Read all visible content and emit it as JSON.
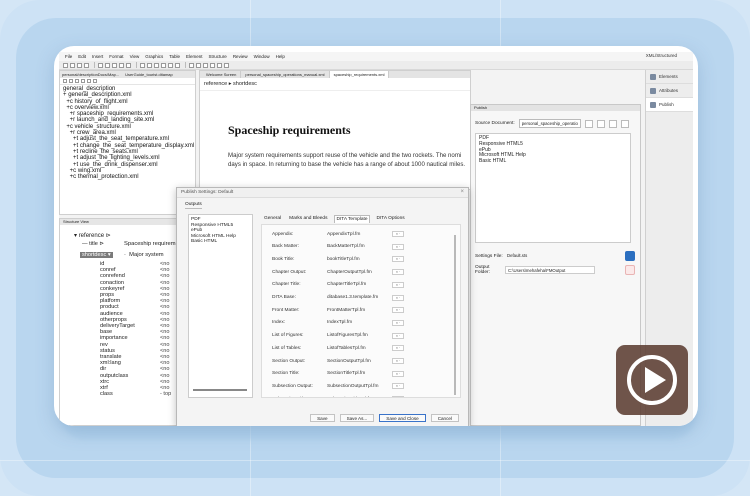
{
  "menubar": {
    "items": [
      "File",
      "Edit",
      "Insert",
      "Format",
      "View",
      "Graphics",
      "Table",
      "Element",
      "Structure",
      "Review",
      "Window",
      "Help"
    ],
    "right_label": "XML/Structured"
  },
  "rightbar": {
    "items": [
      {
        "label": "Elements",
        "icon": "elements-icon"
      },
      {
        "label": "Attributes",
        "icon": "attributes-icon"
      },
      {
        "label": "Publish",
        "icon": "publish-icon",
        "active": true
      }
    ]
  },
  "leftpanel": {
    "tabs": [
      "personal/descriptionDocs/Map...",
      "UserGuide_tourist.ditamap"
    ],
    "tree": [
      {
        "prefix": "",
        "label": "general_description"
      },
      {
        "prefix": "+",
        "label": "general_description.xml"
      },
      {
        "prefix": "  +c",
        "label": "history_of_flight.xml"
      },
      {
        "prefix": "  +c",
        "label": "overview.xml"
      },
      {
        "prefix": "    +r",
        "label": "spaceship_requirements.xml"
      },
      {
        "prefix": "    +r",
        "label": "launch_and_landing_site.xml"
      },
      {
        "prefix": "  +c",
        "label": "vehicle_structure.xml"
      },
      {
        "prefix": "    +r",
        "label": "crew_area.xml"
      },
      {
        "prefix": "      +t",
        "label": "adjust_the_seat_temperature.xml"
      },
      {
        "prefix": "      +t",
        "label": "change_the_seat_temperature_display.xml"
      },
      {
        "prefix": "      +t",
        "label": "recline_the_seats.xml"
      },
      {
        "prefix": "      +t",
        "label": "adjust_the_lighting_levels.xml"
      },
      {
        "prefix": "      +t",
        "label": "use_the_drink_dispenser.xml"
      },
      {
        "prefix": "    +c",
        "label": "wing.xml"
      },
      {
        "prefix": "    +c",
        "label": "thermal_protection.xml"
      }
    ]
  },
  "attrpanel": {
    "header": "Structure View",
    "crumb": "reference",
    "title_node": "title",
    "title_value": "Spaceship requirem",
    "shortdesc_node": "shortdesc",
    "shortdesc_value": "Major system",
    "attrs": [
      {
        "k": "id",
        "v": "<no"
      },
      {
        "k": "conref",
        "v": "<no"
      },
      {
        "k": "conrefend",
        "v": "<no"
      },
      {
        "k": "conaction",
        "v": "<no"
      },
      {
        "k": "conkeyref",
        "v": "<no"
      },
      {
        "k": "props",
        "v": "<no"
      },
      {
        "k": "platform",
        "v": "<no"
      },
      {
        "k": "product",
        "v": "<no"
      },
      {
        "k": "audience",
        "v": "<no"
      },
      {
        "k": "otherprops",
        "v": "<no"
      },
      {
        "k": "deliveryTarget",
        "v": "<no"
      },
      {
        "k": "base",
        "v": "<no"
      },
      {
        "k": "importance",
        "v": "<no"
      },
      {
        "k": "rev",
        "v": "<no"
      },
      {
        "k": "status",
        "v": "<no"
      },
      {
        "k": "translate",
        "v": "<no"
      },
      {
        "k": "xml:lang",
        "v": "<no"
      },
      {
        "k": "dir",
        "v": "<no"
      },
      {
        "k": "outputclass",
        "v": "<no"
      },
      {
        "k": "xtrc",
        "v": "<no"
      },
      {
        "k": "xtrf",
        "v": "<no"
      },
      {
        "k": "class",
        "v": "- top"
      }
    ]
  },
  "editor": {
    "tabs": [
      "Welcome Screen",
      "personal_spaceship_operations_manual.xml",
      "spaceship_requirements.xml"
    ],
    "crumb": "reference  ▸  shortdesc",
    "title": "Spaceship requirements",
    "body_line1": "Major system requirements support reuse of the vehicle and the two rockets. The nomi",
    "body_line2": "days in space. In returning to base the vehicle has a range of about 1000 nautical miles."
  },
  "publish": {
    "header": "Publish",
    "source_label": "Source Document:",
    "source_value": "personal_spaceship_operatio",
    "outputs": [
      "PDF",
      "Responsive HTML5",
      "ePub",
      "Microsoft HTML Help",
      "Basic HTML"
    ],
    "settings_label": "Settings File:",
    "settings_value": "Default.sts",
    "folder_label": "Output Folder:",
    "folder_value": "C:\\Users\\mehafeha\\FMOutput"
  },
  "dialog": {
    "title": "Publish Settings: Default",
    "close": "×",
    "section": "Outputs",
    "outputs": [
      "PDF",
      "Responsive HTML5",
      "ePub",
      "Microsoft HTML Help",
      "Basic HTML"
    ],
    "tabs": [
      "General",
      "Marks and Bleeds",
      "DITA Template",
      "DITA Options"
    ],
    "active_tab": 2,
    "rows": [
      {
        "label": "Appendix:",
        "value": "AppendixTpl.fm"
      },
      {
        "label": "Back Matter:",
        "value": "BackMatterTpl.fm"
      },
      {
        "label": "Book Title:",
        "value": "bookTitleTpl.fm"
      },
      {
        "label": "Chapter Output:",
        "value": "ChapterOutputTpl.fm"
      },
      {
        "label": "Chapter Title:",
        "value": "ChapterTitleTpl.fm"
      },
      {
        "label": "DITA Base:",
        "value": "ditabase1.3.template.fm"
      },
      {
        "label": "Front Matter:",
        "value": "FrontMatterTpl.fm"
      },
      {
        "label": "Index:",
        "value": "IndexTpl.fm"
      },
      {
        "label": "List of Figures:",
        "value": "ListofFiguresTpl.fm"
      },
      {
        "label": "List of Tables:",
        "value": "ListofTablesTpl.fm"
      },
      {
        "label": "Section Output:",
        "value": "SectionOutputTpl.fm"
      },
      {
        "label": "Section Title:",
        "value": "SectionTitleTpl.fm"
      },
      {
        "label": "Subsection Output:",
        "value": "SubsectionOutputTpl.fm"
      },
      {
        "label": "Subsection Title:",
        "value": "SubsectionTitleTpl.fm"
      }
    ],
    "row_button": "× ·",
    "buttons": {
      "save": "Save",
      "save_as": "Save As...",
      "save_close": "Save and Close",
      "cancel": "Cancel"
    }
  },
  "colors": {
    "accent": "#2b6fc0",
    "video_bg": "#5c3d32",
    "page_bg": "#d4e6f6"
  }
}
